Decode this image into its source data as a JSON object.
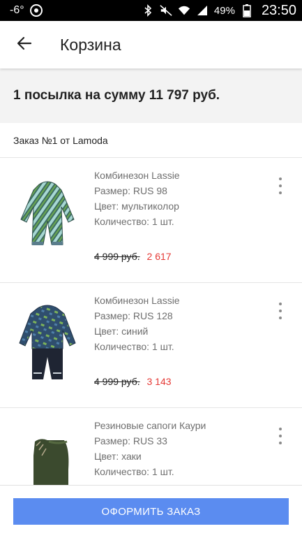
{
  "status_bar": {
    "temperature": "-6°",
    "battery_percent": "49%",
    "time": "23:50",
    "icons": [
      "chrome-icon",
      "bluetooth-icon",
      "mute-icon",
      "wifi-icon",
      "signal-icon",
      "battery-icon"
    ]
  },
  "header": {
    "title": "Корзина",
    "back_icon": "arrow-left-icon"
  },
  "summary": {
    "text": "1 посылка на сумму 11 797 руб."
  },
  "order": {
    "title": "Заказ №1 от Lamoda"
  },
  "items": [
    {
      "name": "Комбинезон Lassie",
      "size": "Размер: RUS 98",
      "color": "Цвет: мультиколор",
      "quantity": "Количество: 1 шт.",
      "old_price": "4 999 руб.",
      "new_price": "2 617"
    },
    {
      "name": "Комбинезон Lassie",
      "size": "Размер: RUS 128",
      "color": "Цвет: синий",
      "quantity": "Количество: 1 шт.",
      "old_price": "4 999 руб.",
      "new_price": "3 143"
    },
    {
      "name": "Резиновые сапоги Каури",
      "size": "Размер: RUS 33",
      "color": "Цвет: хаки",
      "quantity": "Количество: 1 шт."
    }
  ],
  "checkout": {
    "label": "ОФОРМИТЬ ЗАКАЗ"
  },
  "colors": {
    "accent": "#5b8cf0",
    "sale_price": "#e53935",
    "summary_bg": "#f3f3f3"
  }
}
